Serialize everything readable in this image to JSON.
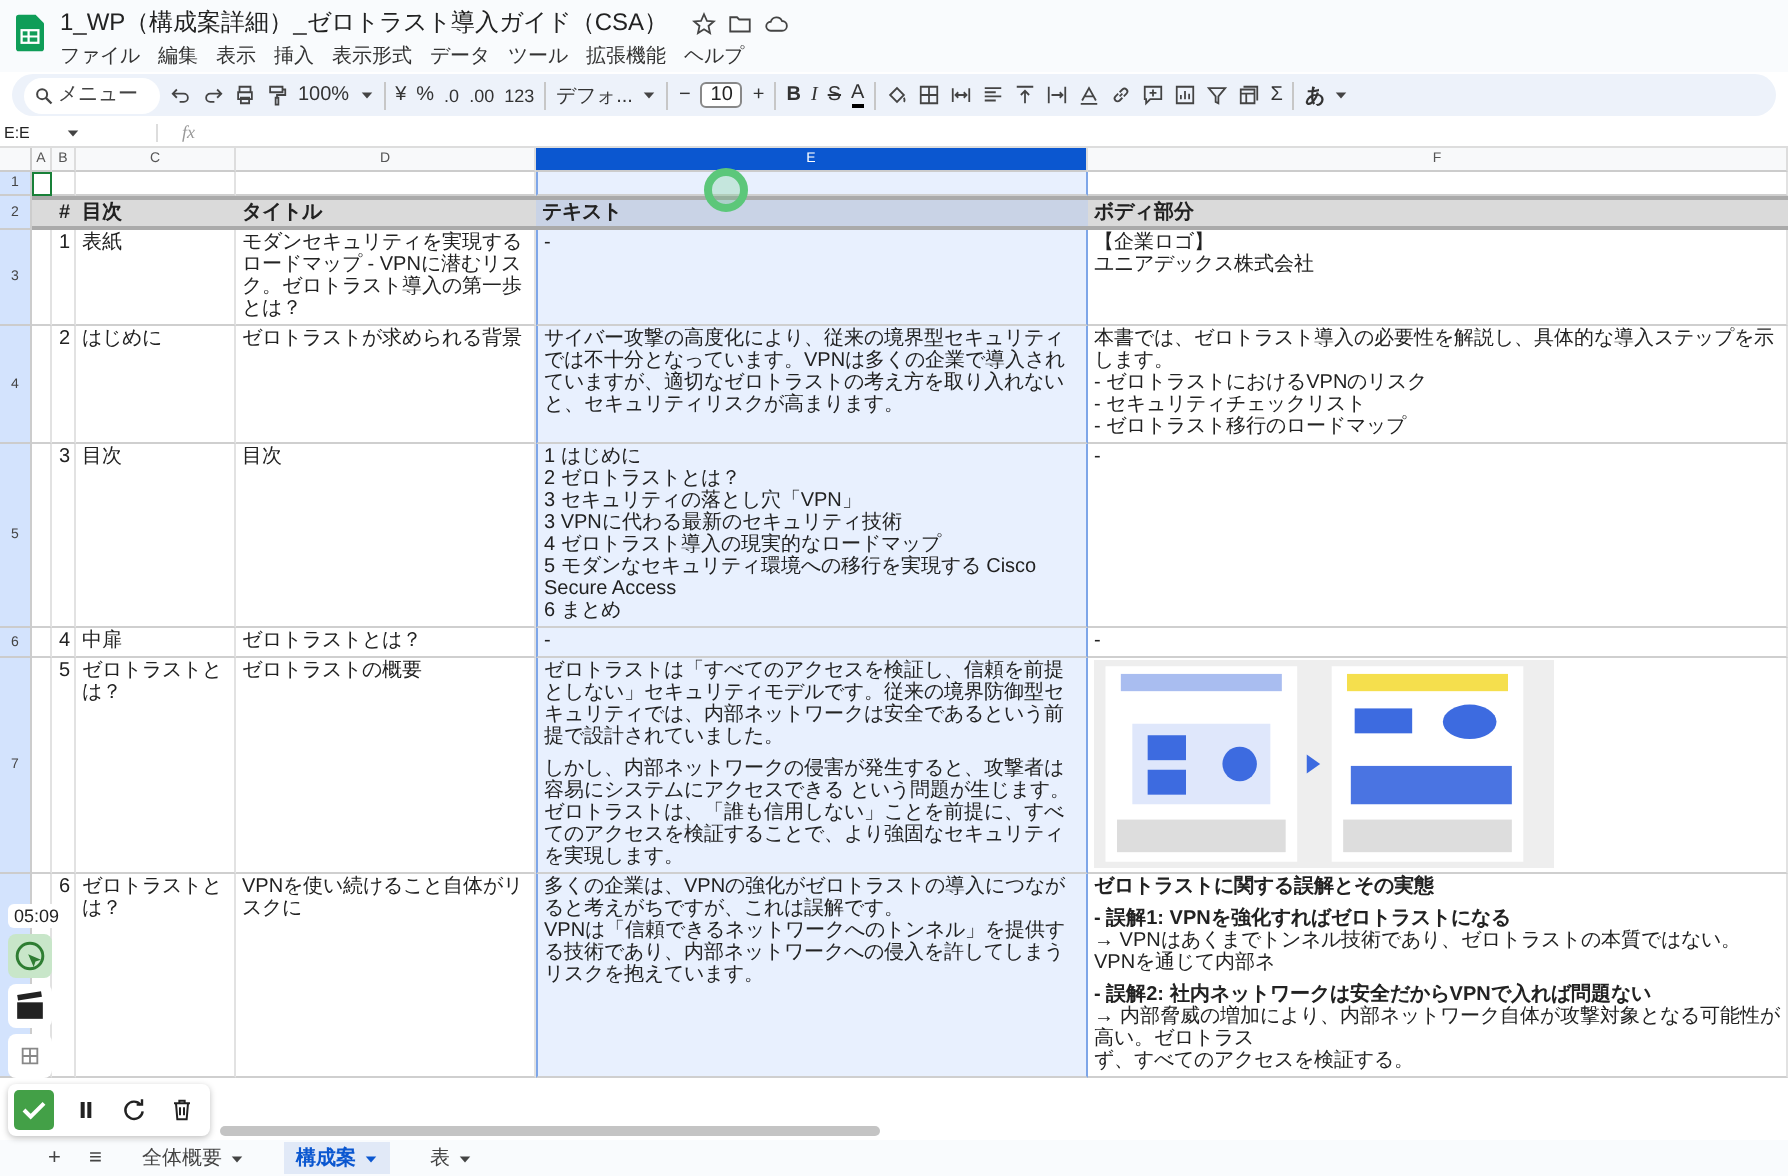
{
  "document": {
    "title": "1_WP（構成案詳細）_ゼロトラスト導入ガイド（CSA）"
  },
  "menu": [
    "ファイル",
    "編集",
    "表示",
    "挿入",
    "表示形式",
    "データ",
    "ツール",
    "拡張機能",
    "ヘルプ"
  ],
  "toolbar": {
    "search_placeholder": "メニュー",
    "zoom": "100%",
    "currency": "¥",
    "percent": "%",
    "decimal_decrease": ".0",
    "decimal_increase": ".00",
    "number_format": "123",
    "font": "デフォ...",
    "minus": "−",
    "font_size": "10",
    "plus": "+",
    "bold": "B",
    "italic": "I",
    "strike": "S",
    "text_color": "A",
    "functions": "Σ",
    "input_tool": "あ"
  },
  "formula_bar": {
    "name_box": "E:E",
    "fx": "fx"
  },
  "columns": [
    {
      "label": "A",
      "selected": false
    },
    {
      "label": "B",
      "selected": false
    },
    {
      "label": "C",
      "selected": false
    },
    {
      "label": "D",
      "selected": false
    },
    {
      "label": "E",
      "selected": true
    },
    {
      "label": "F",
      "selected": false
    }
  ],
  "row_numbers": [
    "1",
    "2",
    "3",
    "4",
    "5",
    "6",
    "7"
  ],
  "header": {
    "num": "#",
    "toc": "目次",
    "title": "タイトル",
    "text": "テキスト",
    "body": "ボディ部分"
  },
  "rows": [
    {
      "num": "1",
      "toc": "表紙",
      "title": "モダンセキュリティを実現するロードマップ - VPNに潜むリスク。ゼロトラスト導入の第一歩とは？",
      "text": "-",
      "body": [
        "【企業ロゴ】",
        "ユニアデックス株式会社"
      ]
    },
    {
      "num": "2",
      "toc": "はじめに",
      "title": "ゼロトラストが求められる背景",
      "text": "サイバー攻撃の高度化により、従来の境界型セキュリティでは不十分となっています。VPNは多くの企業で導入されていますが、適切なゼロトラストの考え方を取り入れないと、セキュリティリスクが高まります。",
      "body": [
        "本書では、ゼロトラスト導入の必要性を解説し、具体的な導入ステップを示します。",
        "- ゼロトラストにおけるVPNのリスク",
        "- セキュリティチェックリスト",
        "- ゼロトラスト移行のロードマップ"
      ]
    },
    {
      "num": "3",
      "toc": "目次",
      "title": "目次",
      "text": [
        "1 はじめに",
        "2 ゼロトラストとは？",
        "3 セキュリティの落とし穴「VPN」",
        "3 VPNに代わる最新のセキュリティ技術",
        "4 ゼロトラスト導入の現実的なロードマップ",
        "5 モダンなセキュリティ環境への移行を実現する Cisco Secure Access",
        "6 まとめ"
      ],
      "body": "-"
    },
    {
      "num": "4",
      "toc": "中扉",
      "title": "ゼロトラストとは？",
      "text": "-",
      "body": "-"
    },
    {
      "num": "5",
      "toc": "ゼロトラストとは？",
      "title": "ゼロトラストの概要",
      "text": [
        [
          "ゼロトラストは「すべてのアクセスを検証し、信頼を前提としない」セキュリティモデルです。従来の境界防御型セキュリティでは、内部ネットワークは安全であるという前提で設計されていました。"
        ],
        [
          "しかし、内部ネットワークの侵害が発生すると、攻撃者は容易にシステムにアクセスできる という問題が生じます。",
          "ゼロトラストは、「誰も信用しない」ことを前提に、すべてのアクセスを検証することで、より強固なセキュリティを実現します。"
        ]
      ],
      "body": {
        "kind": "picture"
      }
    },
    {
      "num": "6",
      "toc": "ゼロトラストとは？",
      "title": "VPNを使い続けること自体がリスクに",
      "text": [
        "多くの企業は、VPNの強化がゼロトラストの導入につながると考えがちですが、これは誤解です。",
        "VPNは「信頼できるネットワークへのトンネル」を提供する技術であり、内部ネットワークへの侵入を許してしまうリスクを抱えています。"
      ],
      "body": [
        [
          {
            "text": "ゼロトラストに関する誤解とその実態",
            "bold": true
          }
        ],
        [
          {
            "text": "- 誤解1: VPNを強化すればゼロトラストになる",
            "bold": true
          },
          {
            "text": "→ VPNはあくまでトンネル技術であり、ゼロトラストの本質ではない。VPNを通じて内部ネ",
            "bold": false
          }
        ],
        [
          {
            "text": "- 誤解2: 社内ネットワークは安全だからVPNで入れば問題ない",
            "bold": true
          },
          {
            "text": "→ 内部脅威の増加により、内部ネットワーク自体が攻撃対象となる可能性が高い。ゼロトラス",
            "bold": false
          },
          {
            "text": "ず、すべてのアクセスを検証する。",
            "bold": false
          }
        ]
      ]
    }
  ],
  "sheet_tabs": [
    {
      "label": "全体概要",
      "selected": false
    },
    {
      "label": "構成案",
      "selected": true
    },
    {
      "label": "表",
      "selected": false
    }
  ],
  "sheet_controls": {
    "add": "+",
    "list": "≡"
  },
  "recorder": {
    "time": "05:09"
  }
}
